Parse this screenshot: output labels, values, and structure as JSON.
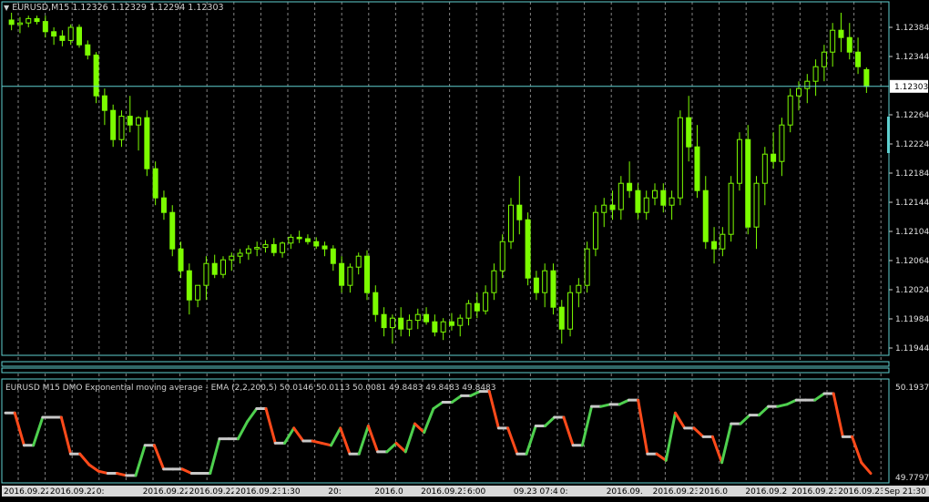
{
  "main": {
    "header": "EURUSD,M15  1.12326 1.12329 1.12294 1.12303",
    "current_price": "1.12303",
    "price_labels": [
      "1.12384",
      "1.12344",
      "1.12264",
      "1.12224",
      "1.12184",
      "1.12144",
      "1.12104",
      "1.12064",
      "1.12024",
      "1.11984",
      "1.11944"
    ]
  },
  "indicator": {
    "header": "EURUSD M15 DMO Exponential moving average - EMA (2,2,200,5) 50.0146 50.0113 50.0081 49.8483 49.8483 49.8483",
    "top_label": "50.1937",
    "bottom_label": "49.7797"
  },
  "time_labels": [
    "2016.09.22 17:30",
    "2016.09.22 22:00",
    "2016.09.23 00:45",
    "2016.09.23 05:15",
    "2016.09.23 07:45",
    "2016.09.23 11:45",
    "2016.09.23 18:00",
    "2016.09.23 20:45"
  ],
  "time_bar_visible_text": [
    "2016.09.22",
    "2016.09.22 17:30",
    "0:",
    "2016.09.22",
    "2016.09.22 22:00",
    "2016.09.23 00:45",
    "1:30",
    "20:",
    "2016.0",
    "2016.09.23 05:15",
    "6:00",
    "09.23 07:45",
    "0:",
    "2016.09.",
    "2016.09.23 11:4",
    "2016.0",
    "2016.09.2",
    "2016.09.23 18:00",
    "2016.09.23 20:45",
    "Sep 21:30"
  ],
  "colors": {
    "background": "#000000",
    "candle": "#7CFC00",
    "frame": "#5fd0d0",
    "grid": "#b0b0b0",
    "ind_up": "#4ed04e",
    "ind_down": "#ff4a1a",
    "ind_flat": "#c8c8c8"
  },
  "chart_data": {
    "type": "candlestick",
    "title": "EURUSD,M15",
    "ohlc_last": {
      "open": 1.12326,
      "high": 1.12329,
      "low": 1.12294,
      "close": 1.12303
    },
    "y_range": [
      1.11944,
      1.12404
    ],
    "candles": [
      [
        1.12394,
        1.12404,
        1.1238,
        1.12388
      ],
      [
        1.12388,
        1.12398,
        1.12376,
        1.1239
      ],
      [
        1.1239,
        1.124,
        1.12384,
        1.12396
      ],
      [
        1.12396,
        1.124,
        1.12388,
        1.12392
      ],
      [
        1.12392,
        1.124,
        1.1237,
        1.12378
      ],
      [
        1.12378,
        1.12384,
        1.1236,
        1.12372
      ],
      [
        1.12372,
        1.1238,
        1.12358,
        1.12366
      ],
      [
        1.12366,
        1.12388,
        1.1236,
        1.12384
      ],
      [
        1.12384,
        1.12388,
        1.12356,
        1.1236
      ],
      [
        1.1236,
        1.12366,
        1.1234,
        1.12346
      ],
      [
        1.12346,
        1.1235,
        1.1228,
        1.1229
      ],
      [
        1.1229,
        1.123,
        1.1225,
        1.1227
      ],
      [
        1.1227,
        1.12278,
        1.1222,
        1.1223
      ],
      [
        1.1223,
        1.1227,
        1.1222,
        1.12262
      ],
      [
        1.12262,
        1.1229,
        1.1224,
        1.1225
      ],
      [
        1.1225,
        1.12262,
        1.12215,
        1.1226
      ],
      [
        1.1226,
        1.1227,
        1.1218,
        1.1219
      ],
      [
        1.1219,
        1.122,
        1.1214,
        1.1215
      ],
      [
        1.1215,
        1.1216,
        1.1212,
        1.1213
      ],
      [
        1.1213,
        1.1214,
        1.1207,
        1.1208
      ],
      [
        1.1208,
        1.1209,
        1.1204,
        1.1205
      ],
      [
        1.1205,
        1.1206,
        1.1199,
        1.1201
      ],
      [
        1.1201,
        1.1202,
        1.12,
        1.1203
      ],
      [
        1.1203,
        1.1207,
        1.1201,
        1.1206
      ],
      [
        1.1206,
        1.12072,
        1.1204,
        1.12045
      ],
      [
        1.12045,
        1.1207,
        1.1204,
        1.12065
      ],
      [
        1.12065,
        1.12075,
        1.1205,
        1.1207
      ],
      [
        1.1207,
        1.1208,
        1.1206,
        1.12074
      ],
      [
        1.12074,
        1.12085,
        1.12065,
        1.1208
      ],
      [
        1.1208,
        1.1209,
        1.1207,
        1.12082
      ],
      [
        1.12082,
        1.12092,
        1.12075,
        1.12086
      ],
      [
        1.12086,
        1.12095,
        1.1207,
        1.12075
      ],
      [
        1.12075,
        1.1209,
        1.12068,
        1.12088
      ],
      [
        1.12088,
        1.121,
        1.1208,
        1.12096
      ],
      [
        1.12096,
        1.12105,
        1.12088,
        1.12094
      ],
      [
        1.12094,
        1.121,
        1.12086,
        1.1209
      ],
      [
        1.1209,
        1.12096,
        1.1208,
        1.12084
      ],
      [
        1.12084,
        1.1209,
        1.1207,
        1.1208
      ],
      [
        1.1208,
        1.12085,
        1.1205,
        1.1206
      ],
      [
        1.1206,
        1.1207,
        1.1202,
        1.1203
      ],
      [
        1.1203,
        1.1206,
        1.1202,
        1.12055
      ],
      [
        1.12055,
        1.12075,
        1.12045,
        1.1207
      ],
      [
        1.1207,
        1.12078,
        1.1201,
        1.1202
      ],
      [
        1.1202,
        1.1203,
        1.1198,
        1.1199
      ],
      [
        1.1199,
        1.12,
        1.1196,
        1.11972
      ],
      [
        1.11972,
        1.1199,
        1.1195,
        1.11985
      ],
      [
        1.11985,
        1.12,
        1.1196,
        1.1197
      ],
      [
        1.1197,
        1.1199,
        1.1196,
        1.11982
      ],
      [
        1.11982,
        1.11998,
        1.1197,
        1.1199
      ],
      [
        1.1199,
        1.12,
        1.11976,
        1.1198
      ],
      [
        1.1198,
        1.1199,
        1.1196,
        1.11966
      ],
      [
        1.11966,
        1.11985,
        1.11955,
        1.1198
      ],
      [
        1.1198,
        1.11992,
        1.11968,
        1.11975
      ],
      [
        1.11975,
        1.1199,
        1.1196,
        1.11985
      ],
      [
        1.11985,
        1.1201,
        1.11975,
        1.12005
      ],
      [
        1.12005,
        1.1202,
        1.11985,
        1.11995
      ],
      [
        1.11995,
        1.1203,
        1.1199,
        1.1202
      ],
      [
        1.1202,
        1.1206,
        1.1201,
        1.1205
      ],
      [
        1.1205,
        1.121,
        1.1204,
        1.1209
      ],
      [
        1.1209,
        1.1215,
        1.1208,
        1.1214
      ],
      [
        1.1214,
        1.1218,
        1.121,
        1.1212
      ],
      [
        1.1212,
        1.1213,
        1.1203,
        1.1204
      ],
      [
        1.1204,
        1.1205,
        1.1201,
        1.1202
      ],
      [
        1.1202,
        1.1206,
        1.12,
        1.1205
      ],
      [
        1.1205,
        1.1206,
        1.1199,
        1.12
      ],
      [
        1.12,
        1.1201,
        1.1195,
        1.1197
      ],
      [
        1.1197,
        1.1203,
        1.1196,
        1.1202
      ],
      [
        1.1202,
        1.1204,
        1.12,
        1.1203
      ],
      [
        1.1203,
        1.1209,
        1.1202,
        1.1208
      ],
      [
        1.1208,
        1.1214,
        1.1207,
        1.1213
      ],
      [
        1.1213,
        1.1215,
        1.1211,
        1.1214
      ],
      [
        1.1214,
        1.1216,
        1.1212,
        1.12134
      ],
      [
        1.12134,
        1.1218,
        1.1212,
        1.1217
      ],
      [
        1.1217,
        1.122,
        1.1215,
        1.1216
      ],
      [
        1.1216,
        1.1217,
        1.1212,
        1.1213
      ],
      [
        1.1213,
        1.1216,
        1.1212,
        1.1215
      ],
      [
        1.1215,
        1.1217,
        1.1214,
        1.1216
      ],
      [
        1.1216,
        1.1217,
        1.1213,
        1.1214
      ],
      [
        1.1214,
        1.1216,
        1.1212,
        1.1215
      ],
      [
        1.1215,
        1.1227,
        1.1214,
        1.1226
      ],
      [
        1.1226,
        1.1229,
        1.122,
        1.1222
      ],
      [
        1.1222,
        1.1225,
        1.1215,
        1.1216
      ],
      [
        1.1216,
        1.1218,
        1.1208,
        1.1209
      ],
      [
        1.1209,
        1.1211,
        1.1206,
        1.1208
      ],
      [
        1.1208,
        1.1211,
        1.1207,
        1.121
      ],
      [
        1.121,
        1.1218,
        1.1209,
        1.1217
      ],
      [
        1.1217,
        1.1224,
        1.1216,
        1.1223
      ],
      [
        1.1223,
        1.1225,
        1.121,
        1.1211
      ],
      [
        1.1211,
        1.1218,
        1.1208,
        1.1217
      ],
      [
        1.1217,
        1.1222,
        1.1214,
        1.1221
      ],
      [
        1.1221,
        1.1224,
        1.1219,
        1.122
      ],
      [
        1.122,
        1.1226,
        1.1218,
        1.1225
      ],
      [
        1.1225,
        1.123,
        1.1224,
        1.1229
      ],
      [
        1.1229,
        1.1231,
        1.1227,
        1.123
      ],
      [
        1.123,
        1.1232,
        1.1228,
        1.1231
      ],
      [
        1.1231,
        1.1234,
        1.1229,
        1.1233
      ],
      [
        1.1233,
        1.1236,
        1.1231,
        1.1235
      ],
      [
        1.1235,
        1.1239,
        1.1233,
        1.1238
      ],
      [
        1.1238,
        1.12404,
        1.1235,
        1.1237
      ],
      [
        1.1237,
        1.1239,
        1.1234,
        1.1235
      ],
      [
        1.1235,
        1.1237,
        1.1232,
        1.1233
      ],
      [
        1.12326,
        1.12329,
        1.12294,
        1.12303
      ]
    ],
    "indicator": {
      "name": "DMO Exponential moving average - EMA (2,2,200,5)",
      "y_range": [
        49.7797,
        50.1937
      ],
      "values": [
        50.07,
        50.07,
        49.92,
        49.92,
        50.05,
        50.05,
        50.05,
        49.88,
        49.88,
        49.83,
        49.8,
        49.79,
        49.79,
        49.78,
        49.78,
        49.92,
        49.92,
        49.81,
        49.81,
        49.81,
        49.79,
        49.79,
        49.79,
        49.95,
        49.95,
        49.95,
        50.03,
        50.09,
        50.09,
        49.93,
        49.93,
        50.0,
        49.94,
        49.94,
        49.93,
        49.92,
        50.0,
        49.88,
        49.88,
        50.01,
        49.89,
        49.89,
        49.93,
        49.89,
        50.02,
        49.98,
        50.09,
        50.12,
        50.12,
        50.15,
        50.15,
        50.17,
        50.17,
        50.0,
        50.0,
        49.88,
        49.88,
        50.01,
        50.01,
        50.05,
        50.05,
        49.92,
        49.92,
        50.1,
        50.1,
        50.11,
        50.11,
        50.13,
        50.13,
        49.88,
        49.88,
        49.85,
        50.07,
        50.0,
        50.0,
        49.96,
        49.96,
        49.84,
        50.02,
        50.02,
        50.06,
        50.06,
        50.1,
        50.1,
        50.11,
        50.13,
        50.13,
        50.13,
        50.16,
        50.16,
        49.96,
        49.96,
        49.84,
        49.79
      ]
    }
  }
}
